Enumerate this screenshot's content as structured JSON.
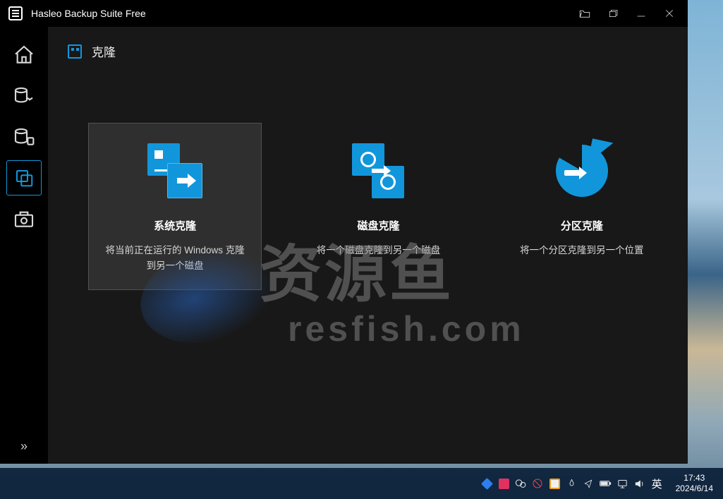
{
  "app": {
    "title": "Hasleo Backup Suite Free"
  },
  "page": {
    "title": "克隆"
  },
  "cards": [
    {
      "name": "系统克隆",
      "desc": "将当前正在运行的 Windows 克隆到另一个磁盘"
    },
    {
      "name": "磁盘克隆",
      "desc": "将一个磁盘克隆到另一个磁盘"
    },
    {
      "name": "分区克隆",
      "desc": "将一个分区克隆到另一个位置"
    }
  ],
  "watermark": {
    "line1": "资源鱼",
    "line2": "resfish.com"
  },
  "taskbar": {
    "ime": "英",
    "time": "17:43",
    "date": "2024/6/14"
  },
  "colors": {
    "accent": "#1296db"
  }
}
